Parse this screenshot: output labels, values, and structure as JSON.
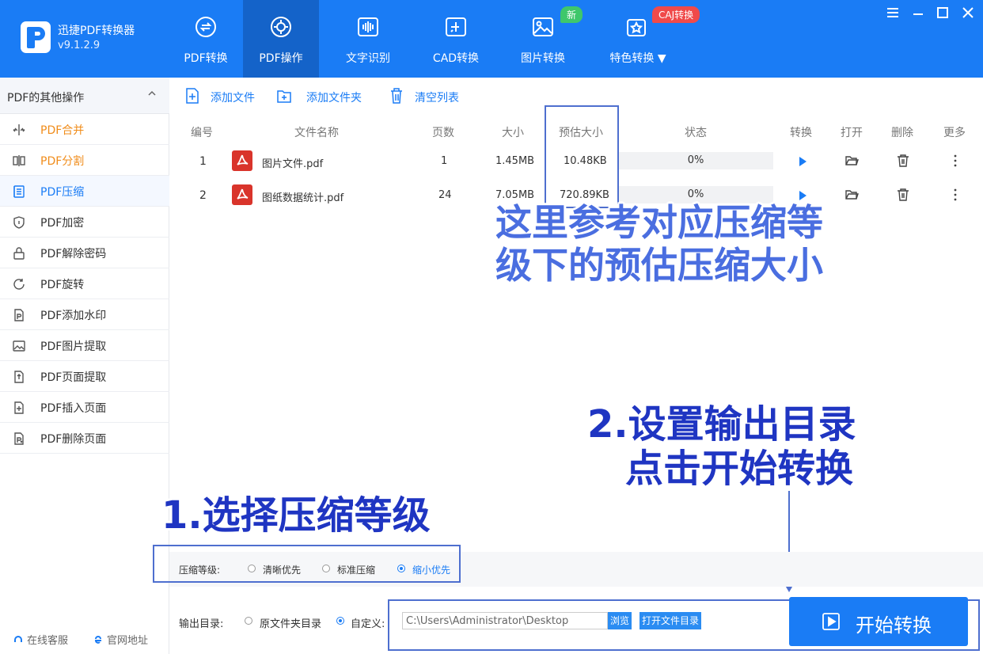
{
  "app": {
    "name": "迅捷PDF转换器",
    "version": "v9.1.2.9"
  },
  "nav": {
    "tabs": [
      {
        "label": "PDF转换",
        "icon": "refresh-icon"
      },
      {
        "label": "PDF操作",
        "icon": "gear-icon",
        "active": true
      },
      {
        "label": "文字识别",
        "icon": "waveform-icon"
      },
      {
        "label": "CAD转换",
        "icon": "cad-icon"
      },
      {
        "label": "图片转换",
        "icon": "image-icon"
      },
      {
        "label": "特色转换",
        "icon": "star-icon"
      }
    ],
    "badge_new": "新",
    "badge_caj": "CAJ转换"
  },
  "sidebar": {
    "title": "PDF的其他操作",
    "items": [
      {
        "label": "PDF合并",
        "icon": "merge-icon"
      },
      {
        "label": "PDF分割",
        "icon": "split-icon"
      },
      {
        "label": "PDF压缩",
        "icon": "compress-icon"
      },
      {
        "label": "PDF加密",
        "icon": "shield-icon"
      },
      {
        "label": "PDF解除密码",
        "icon": "lock-icon"
      },
      {
        "label": "PDF旋转",
        "icon": "rotate-icon"
      },
      {
        "label": "PDF添加水印",
        "icon": "watermark-icon"
      },
      {
        "label": "PDF图片提取",
        "icon": "image-extract-icon"
      },
      {
        "label": "PDF页面提取",
        "icon": "page-extract-icon"
      },
      {
        "label": "PDF插入页面",
        "icon": "page-insert-icon"
      },
      {
        "label": "PDF删除页面",
        "icon": "page-delete-icon"
      }
    ],
    "footer": {
      "support": "在线客服",
      "website": "官网地址"
    }
  },
  "toolbar": {
    "add_file": "添加文件",
    "add_folder": "添加文件夹",
    "clear_list": "清空列表"
  },
  "table": {
    "headers": {
      "no": "编号",
      "name": "文件名称",
      "pages": "页数",
      "size": "大小",
      "estimated": "预估大小",
      "status": "状态",
      "convert": "转换",
      "open": "打开",
      "delete": "删除",
      "more": "更多"
    },
    "rows": [
      {
        "no": "1",
        "name": "图片文件.pdf",
        "pages": "1",
        "size": "1.45MB",
        "estimated": "10.48KB",
        "status": "0%"
      },
      {
        "no": "2",
        "name": "图纸数据统计.pdf",
        "pages": "24",
        "size": "7.05MB",
        "estimated": "720.89KB",
        "status": "0%"
      }
    ]
  },
  "annotations": {
    "estimate_line1": "这里参考对应压缩等",
    "estimate_line2": "级下的预估压缩大小",
    "step1": "1.选择压缩等级",
    "step2_line1": "2.设置输出目录",
    "step2_line2": "点击开始转换"
  },
  "compress": {
    "label": "压缩等级:",
    "options": [
      "清晰优先",
      "标准压缩",
      "缩小优先"
    ],
    "selected": "缩小优先"
  },
  "output": {
    "label": "输出目录:",
    "option_source": "原文件夹目录",
    "option_custom": "自定义:",
    "path": "C:\\Users\\Administrator\\Desktop",
    "browse": "浏览",
    "open_dir": "打开文件目录"
  },
  "start_button": "开始转换",
  "colors": {
    "brand": "#1a7cf5",
    "annotation": "#4a6ee0",
    "pdf_red": "#d9342b",
    "accent_orange": "#f08c1a"
  }
}
